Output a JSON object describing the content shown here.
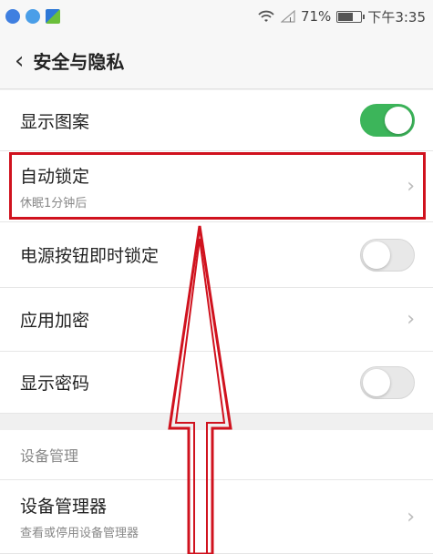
{
  "status_bar": {
    "app_icons": [
      "app-icon-1",
      "app-icon-2",
      "app-icon-3"
    ],
    "wifi_icon": "wifi-icon",
    "signal_icon": "signal-icon",
    "battery_percent": "71%",
    "battery_level": 0.71,
    "time": "下午3:35"
  },
  "header": {
    "back_icon": "chevron-left-icon",
    "title": "安全与隐私"
  },
  "settings": {
    "show_pattern": {
      "label": "显示图案",
      "toggle_on": true
    },
    "auto_lock": {
      "label": "自动锁定",
      "subtitle": "休眠1分钟后"
    },
    "power_button_lock": {
      "label": "电源按钮即时锁定",
      "toggle_on": false
    },
    "app_encryption": {
      "label": "应用加密"
    },
    "show_password": {
      "label": "显示密码",
      "toggle_on": false
    }
  },
  "device_section": {
    "header": "设备管理",
    "device_admin": {
      "label": "设备管理器",
      "subtitle": "查看或停用设备管理器"
    }
  },
  "colors": {
    "toggle_on": "#3cb55a",
    "highlight": "#d0121e"
  }
}
